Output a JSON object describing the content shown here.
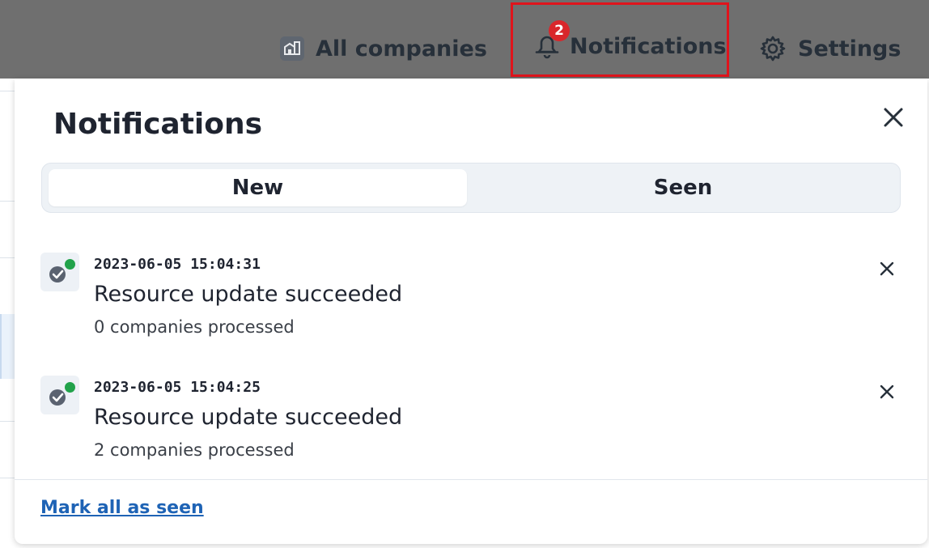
{
  "header": {
    "companies_label": "All companies",
    "notifications_label": "Notifications",
    "notifications_count": "2",
    "settings_label": "Settings",
    "highlight_color": "#e0141c"
  },
  "panel": {
    "title": "Notifications",
    "tabs": [
      {
        "label": "New",
        "active": true
      },
      {
        "label": "Seen",
        "active": false
      }
    ],
    "notifications": [
      {
        "timestamp": "2023-06-05 15:04:31",
        "title": "Resource update succeeded",
        "detail": "0 companies processed",
        "status": "success"
      },
      {
        "timestamp": "2023-06-05 15:04:25",
        "title": "Resource update succeeded",
        "detail": "2 companies processed",
        "status": "success"
      }
    ],
    "mark_all_label": "Mark all as seen"
  },
  "icons": {
    "companies": "buildings-icon",
    "notifications": "bell-icon",
    "settings": "gear-icon",
    "close": "close-icon",
    "status": "check-circle-icon",
    "dismiss": "dismiss-icon"
  },
  "colors": {
    "header_bg": "#6f6f6f",
    "badge": "#d9262b",
    "success_dot": "#21a24a",
    "link": "#1e63b5"
  }
}
